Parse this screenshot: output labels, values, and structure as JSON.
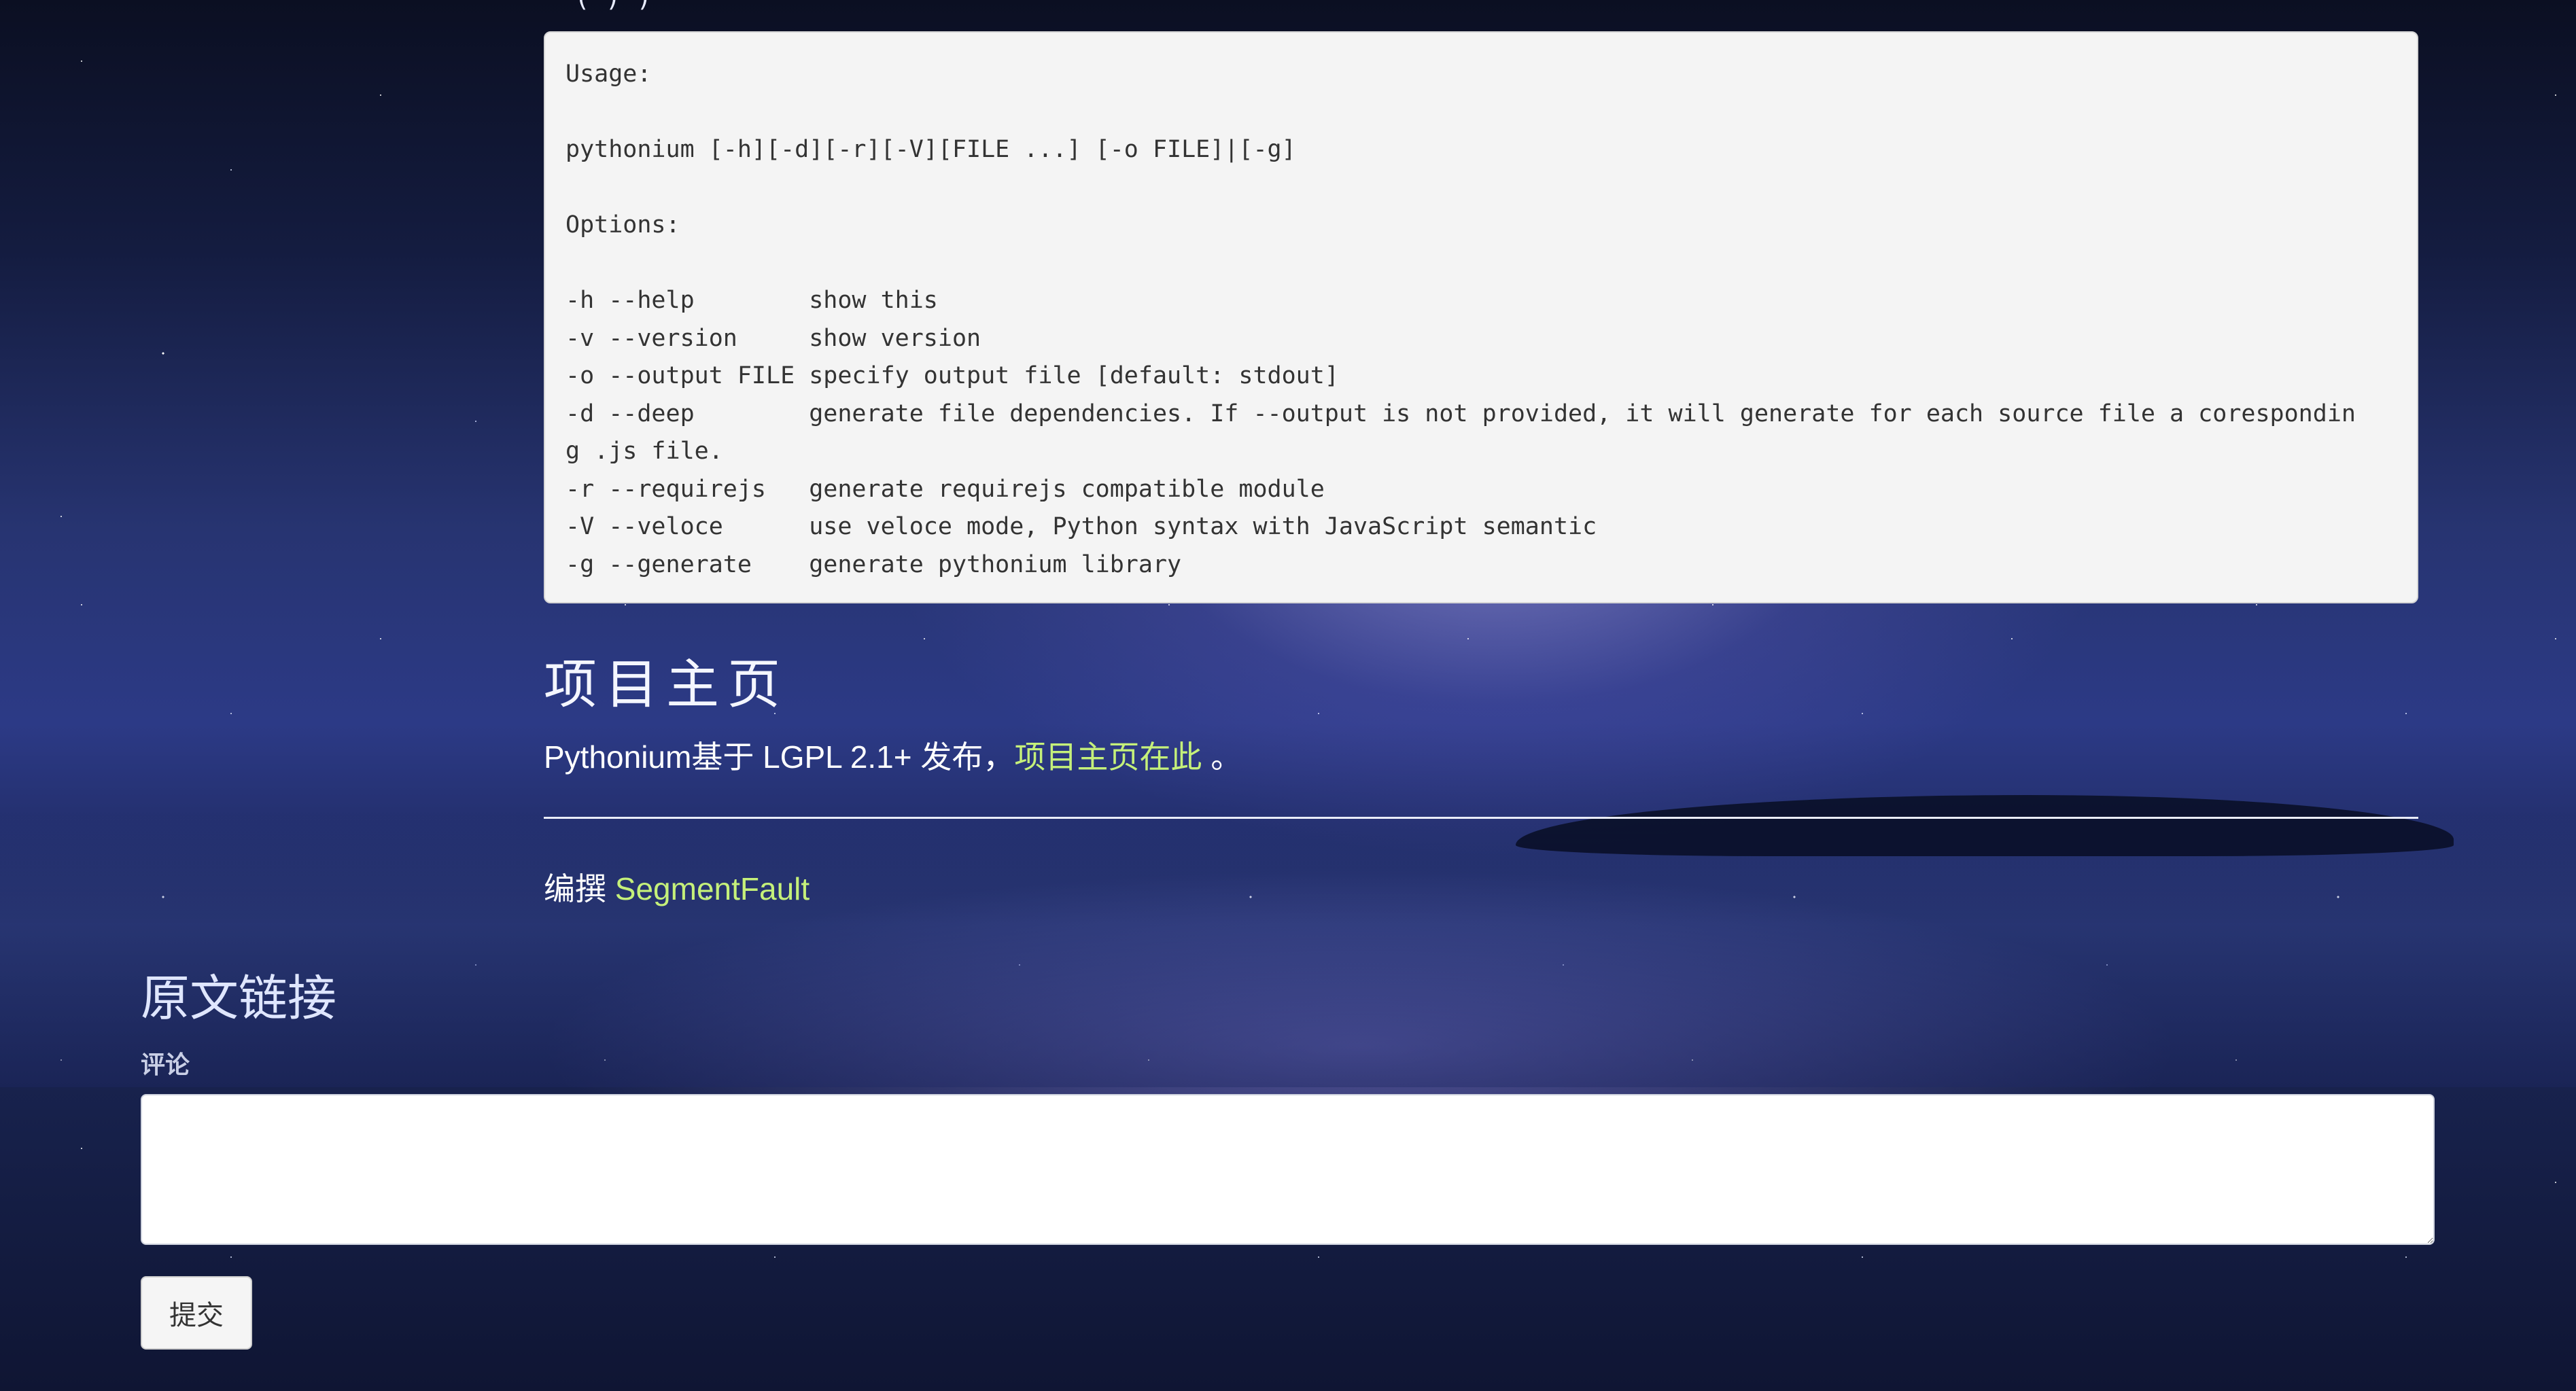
{
  "article": {
    "cut_text": "·(·)·)",
    "code_block": "Usage:\n\npythonium [-h][-d][-r][-V][FILE ...] [-o FILE]|[-g]\n\nOptions:\n\n-h --help        show this\n-v --version     show version\n-o --output FILE specify output file [default: stdout]\n-d --deep        generate file dependencies. If --output is not provided, it will generate for each source file a corespondin\ng .js file.\n-r --requirejs   generate requirejs compatible module\n-V --veloce      use veloce mode, Python syntax with JavaScript semantic\n-g --generate    generate pythonium library",
    "section_title": "项目主页",
    "description_prefix": "Pythonium基于 LGPL 2.1+ 发布，",
    "project_link": "项目主页在此",
    "description_suffix": "。",
    "editor_prefix": "编撰",
    "editor_link": "SegmentFault"
  },
  "comments": {
    "original_link_title": "原文链接",
    "label": "评论",
    "textarea_value": "",
    "submit_label": "提交"
  },
  "colors": {
    "link": "#c5f07a",
    "code_background": "#f4f4f4",
    "text_light": "#ffffff"
  }
}
